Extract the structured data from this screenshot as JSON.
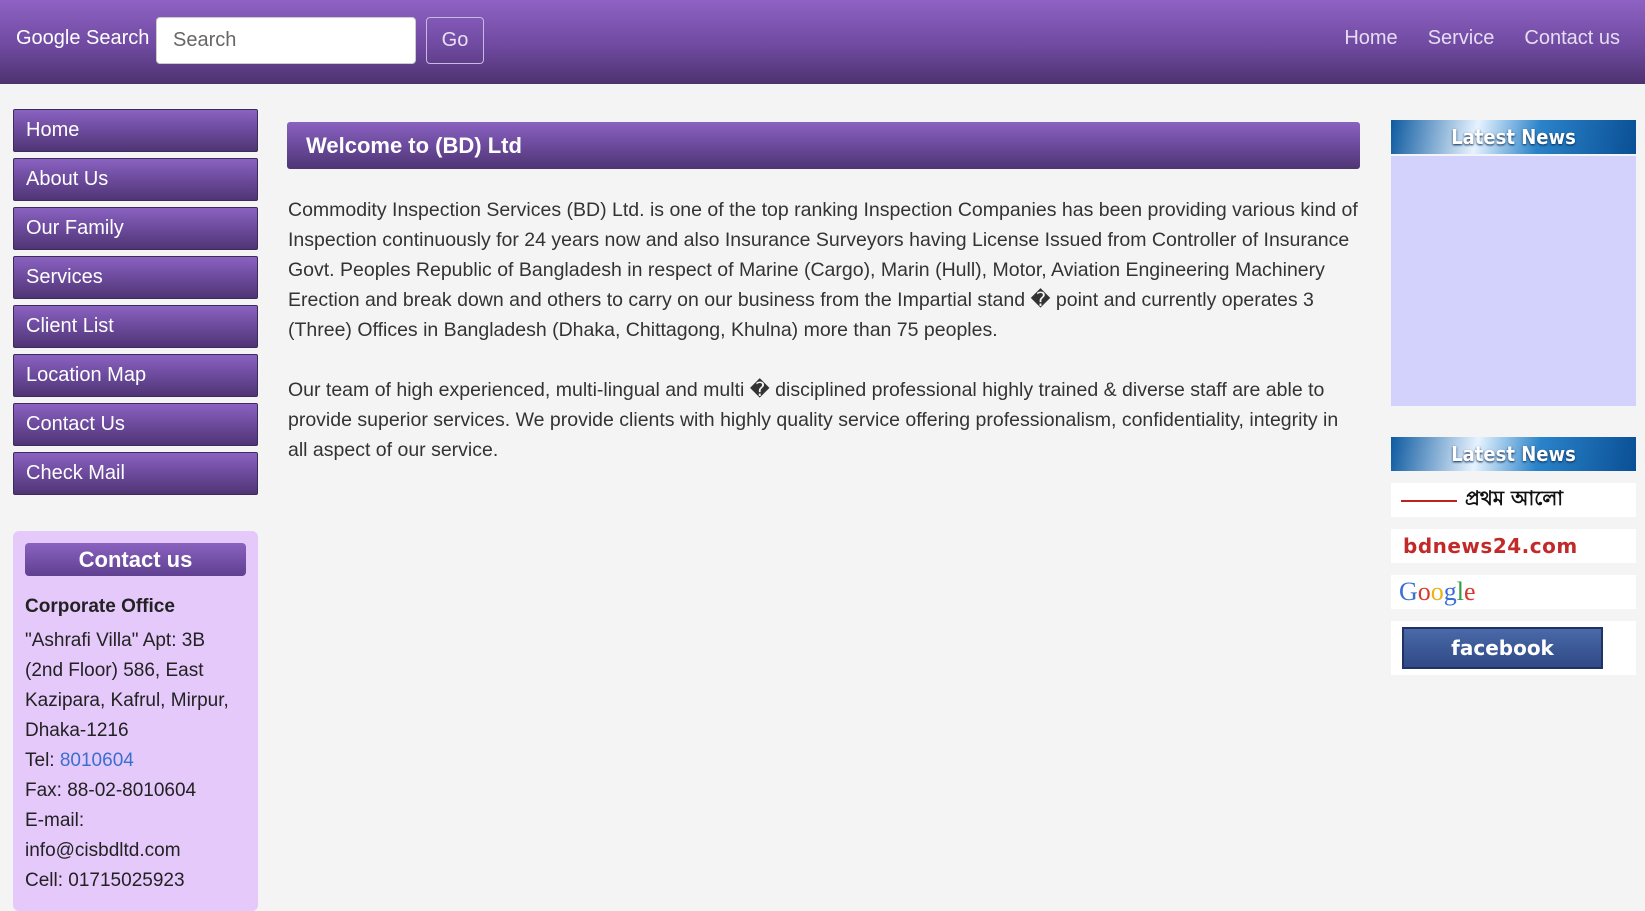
{
  "navbar": {
    "brand": "Google Search",
    "search_placeholder": "Search",
    "go_label": "Go",
    "links": [
      "Home",
      "Service",
      "Contact us"
    ]
  },
  "sidebar": {
    "items": [
      "Home",
      "About Us",
      "Our Family",
      "Services",
      "Client List",
      "Location Map",
      "Contact Us",
      "Check Mail"
    ]
  },
  "contact": {
    "heading": "Contact us",
    "office_title": "Corporate Office",
    "address": "\"Ashrafi Villa\" Apt: 3B (2nd Floor) 586, East Kazipara, Kafrul, Mirpur, Dhaka-1216",
    "tel_label": "Tel: ",
    "tel_value": "8010604",
    "fax": "Fax: 88-02-8010604",
    "email_label": "E-mail:",
    "email_value": "info@cisbdltd.com",
    "cell": "Cell: 01715025923"
  },
  "main": {
    "title": "Welcome to (BD) Ltd",
    "paragraph1": "Commodity Inspection Services (BD) Ltd. is one of the top ranking Inspection Companies has been providing various kind of Inspection continuously for 24 years now and also Insurance Surveyors having License Issued from Controller of Insurance Govt. Peoples Republic of Bangladesh in respect of Marine (Cargo), Marin (Hull), Motor, Aviation Engineering Machinery Erection and break down and others to carry on our business from the Impartial stand � point and currently operates 3 (Three) Offices in Bangladesh (Dhaka, Chittagong, Khulna) more than 75 peoples.",
    "paragraph2": "Our team of high experienced, multi-lingual and multi � disciplined professional highly trained & diverse staff are able to provide superior services. We provide clients with highly quality service offering professionalism, confidentiality, integrity in all aspect of our service."
  },
  "right": {
    "banner1": "Latest News",
    "banner2": "Latest News",
    "logos": {
      "prothom_alo": "প্রথম আলো",
      "bdnews": "bdnews24.com",
      "google": "Google",
      "facebook": "facebook"
    },
    "colors": {
      "google_blue": "#3b6fd8",
      "google_red": "#d9382c",
      "google_yellow": "#e8b419",
      "google_green": "#2f9e44"
    }
  }
}
